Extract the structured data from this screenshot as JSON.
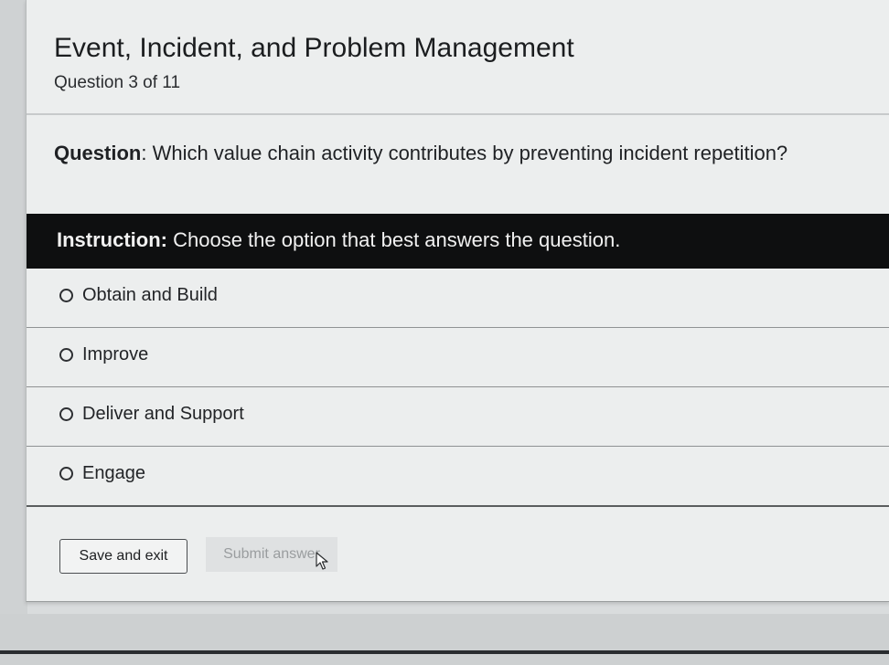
{
  "header": {
    "title": "Event, Incident, and Problem Management",
    "progress": "Question 3 of 11"
  },
  "question": {
    "label": "Question",
    "text": ": Which value chain activity contributes by preventing incident repetition?"
  },
  "instruction": {
    "label": "Instruction:",
    "text": " Choose the option that best answers the question."
  },
  "options": [
    {
      "label": "Obtain and Build",
      "selected": false
    },
    {
      "label": "Improve",
      "selected": false
    },
    {
      "label": "Deliver and Support",
      "selected": false
    },
    {
      "label": "Engage",
      "selected": false
    }
  ],
  "footer": {
    "save_label": "Save and exit",
    "submit_label": "Submit answer",
    "submit_enabled": false
  },
  "icons": {
    "cursor": "mouse-pointer-icon",
    "radio": "radio-unchecked-icon"
  }
}
